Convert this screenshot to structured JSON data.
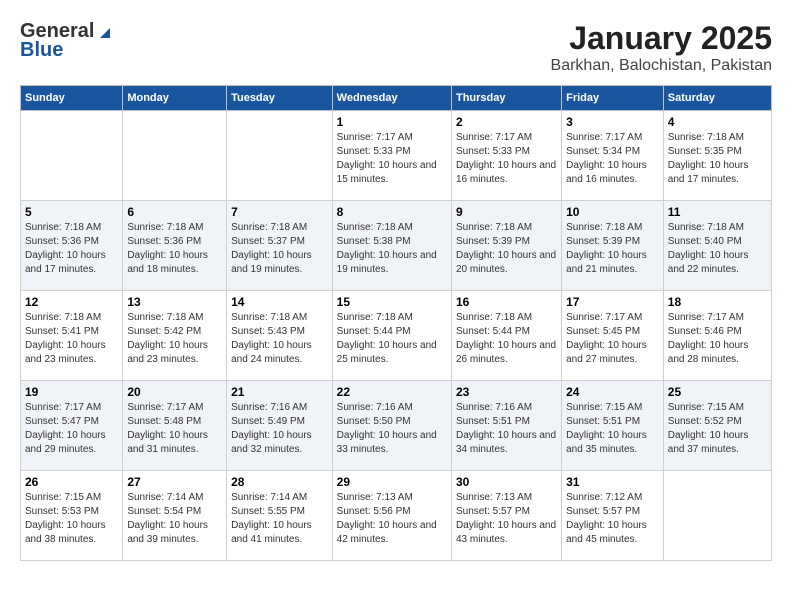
{
  "header": {
    "logo_general": "General",
    "logo_blue": "Blue",
    "title": "January 2025",
    "subtitle": "Barkhan, Balochistan, Pakistan"
  },
  "calendar": {
    "days_of_week": [
      "Sunday",
      "Monday",
      "Tuesday",
      "Wednesday",
      "Thursday",
      "Friday",
      "Saturday"
    ],
    "weeks": [
      {
        "cells": [
          {
            "day": "",
            "content": ""
          },
          {
            "day": "",
            "content": ""
          },
          {
            "day": "",
            "content": ""
          },
          {
            "day": "1",
            "content": "Sunrise: 7:17 AM\nSunset: 5:33 PM\nDaylight: 10 hours\nand 15 minutes."
          },
          {
            "day": "2",
            "content": "Sunrise: 7:17 AM\nSunset: 5:33 PM\nDaylight: 10 hours\nand 16 minutes."
          },
          {
            "day": "3",
            "content": "Sunrise: 7:17 AM\nSunset: 5:34 PM\nDaylight: 10 hours\nand 16 minutes."
          },
          {
            "day": "4",
            "content": "Sunrise: 7:18 AM\nSunset: 5:35 PM\nDaylight: 10 hours\nand 17 minutes."
          }
        ]
      },
      {
        "cells": [
          {
            "day": "5",
            "content": "Sunrise: 7:18 AM\nSunset: 5:36 PM\nDaylight: 10 hours\nand 17 minutes."
          },
          {
            "day": "6",
            "content": "Sunrise: 7:18 AM\nSunset: 5:36 PM\nDaylight: 10 hours\nand 18 minutes."
          },
          {
            "day": "7",
            "content": "Sunrise: 7:18 AM\nSunset: 5:37 PM\nDaylight: 10 hours\nand 19 minutes."
          },
          {
            "day": "8",
            "content": "Sunrise: 7:18 AM\nSunset: 5:38 PM\nDaylight: 10 hours\nand 19 minutes."
          },
          {
            "day": "9",
            "content": "Sunrise: 7:18 AM\nSunset: 5:39 PM\nDaylight: 10 hours\nand 20 minutes."
          },
          {
            "day": "10",
            "content": "Sunrise: 7:18 AM\nSunset: 5:39 PM\nDaylight: 10 hours\nand 21 minutes."
          },
          {
            "day": "11",
            "content": "Sunrise: 7:18 AM\nSunset: 5:40 PM\nDaylight: 10 hours\nand 22 minutes."
          }
        ]
      },
      {
        "cells": [
          {
            "day": "12",
            "content": "Sunrise: 7:18 AM\nSunset: 5:41 PM\nDaylight: 10 hours\nand 23 minutes."
          },
          {
            "day": "13",
            "content": "Sunrise: 7:18 AM\nSunset: 5:42 PM\nDaylight: 10 hours\nand 23 minutes."
          },
          {
            "day": "14",
            "content": "Sunrise: 7:18 AM\nSunset: 5:43 PM\nDaylight: 10 hours\nand 24 minutes."
          },
          {
            "day": "15",
            "content": "Sunrise: 7:18 AM\nSunset: 5:44 PM\nDaylight: 10 hours\nand 25 minutes."
          },
          {
            "day": "16",
            "content": "Sunrise: 7:18 AM\nSunset: 5:44 PM\nDaylight: 10 hours\nand 26 minutes."
          },
          {
            "day": "17",
            "content": "Sunrise: 7:17 AM\nSunset: 5:45 PM\nDaylight: 10 hours\nand 27 minutes."
          },
          {
            "day": "18",
            "content": "Sunrise: 7:17 AM\nSunset: 5:46 PM\nDaylight: 10 hours\nand 28 minutes."
          }
        ]
      },
      {
        "cells": [
          {
            "day": "19",
            "content": "Sunrise: 7:17 AM\nSunset: 5:47 PM\nDaylight: 10 hours\nand 29 minutes."
          },
          {
            "day": "20",
            "content": "Sunrise: 7:17 AM\nSunset: 5:48 PM\nDaylight: 10 hours\nand 31 minutes."
          },
          {
            "day": "21",
            "content": "Sunrise: 7:16 AM\nSunset: 5:49 PM\nDaylight: 10 hours\nand 32 minutes."
          },
          {
            "day": "22",
            "content": "Sunrise: 7:16 AM\nSunset: 5:50 PM\nDaylight: 10 hours\nand 33 minutes."
          },
          {
            "day": "23",
            "content": "Sunrise: 7:16 AM\nSunset: 5:51 PM\nDaylight: 10 hours\nand 34 minutes."
          },
          {
            "day": "24",
            "content": "Sunrise: 7:15 AM\nSunset: 5:51 PM\nDaylight: 10 hours\nand 35 minutes."
          },
          {
            "day": "25",
            "content": "Sunrise: 7:15 AM\nSunset: 5:52 PM\nDaylight: 10 hours\nand 37 minutes."
          }
        ]
      },
      {
        "cells": [
          {
            "day": "26",
            "content": "Sunrise: 7:15 AM\nSunset: 5:53 PM\nDaylight: 10 hours\nand 38 minutes."
          },
          {
            "day": "27",
            "content": "Sunrise: 7:14 AM\nSunset: 5:54 PM\nDaylight: 10 hours\nand 39 minutes."
          },
          {
            "day": "28",
            "content": "Sunrise: 7:14 AM\nSunset: 5:55 PM\nDaylight: 10 hours\nand 41 minutes."
          },
          {
            "day": "29",
            "content": "Sunrise: 7:13 AM\nSunset: 5:56 PM\nDaylight: 10 hours\nand 42 minutes."
          },
          {
            "day": "30",
            "content": "Sunrise: 7:13 AM\nSunset: 5:57 PM\nDaylight: 10 hours\nand 43 minutes."
          },
          {
            "day": "31",
            "content": "Sunrise: 7:12 AM\nSunset: 5:57 PM\nDaylight: 10 hours\nand 45 minutes."
          },
          {
            "day": "",
            "content": ""
          }
        ]
      }
    ]
  }
}
